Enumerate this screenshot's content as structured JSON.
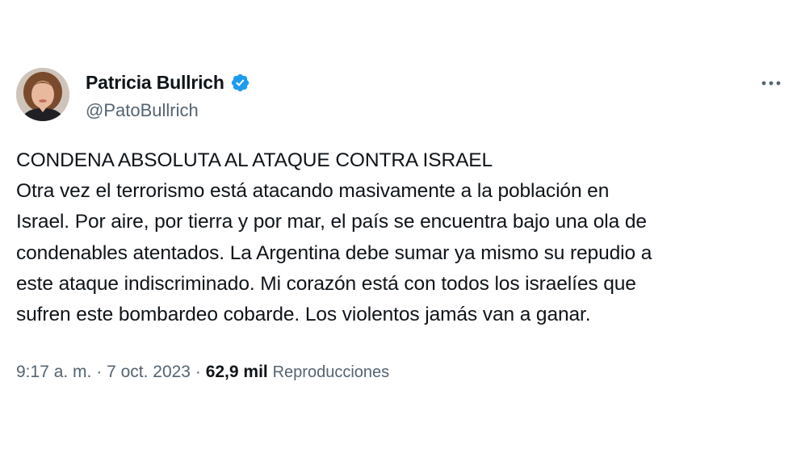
{
  "author": {
    "display_name": "Patricia Bullrich",
    "handle": "@PatoBullrich",
    "verified_icon": "verified-badge-icon",
    "accent_color": "#1d9bf0"
  },
  "menu": {
    "icon": "more-horizontal-icon"
  },
  "tweet": {
    "lines": [
      "CONDENA ABSOLUTA AL ATAQUE CONTRA ISRAEL",
      "Otra vez el terrorismo está atacando masivamente a la población en",
      "Israel. Por aire, por tierra y por mar, el país se encuentra bajo una ola de",
      "condenables atentados. La Argentina debe sumar ya mismo su repudio a",
      "este ataque indiscriminado. Mi corazón está con todos los israelíes que",
      "sufren este bombardeo cobarde. Los violentos jamás van a ganar."
    ]
  },
  "meta": {
    "time": "9:17 a. m.",
    "separator": "·",
    "date": "7 oct. 2023",
    "views_count": "62,9 mil",
    "views_label": "Reproducciones"
  }
}
